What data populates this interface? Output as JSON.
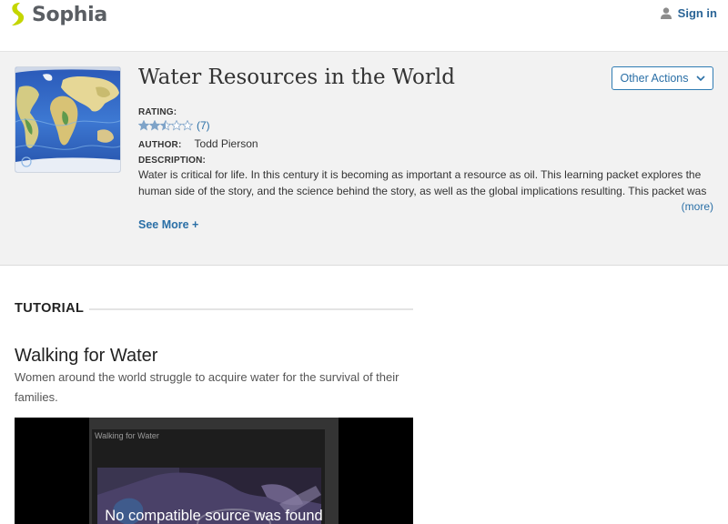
{
  "header": {
    "brand": "Sophia",
    "signin_label": "Sign in",
    "brand_color": "#c4d600",
    "link_color": "#2a6496"
  },
  "resource": {
    "title": "Water Resources in the World",
    "other_actions_label": "Other Actions",
    "rating_label": "RATING:",
    "rating_value": 2.5,
    "rating_max": 5,
    "rating_count": "(7)",
    "author_label": "AUTHOR:",
    "author_name": "Todd Pierson",
    "description_label": "DESCRIPTION:",
    "description_line1": "Water is critical for life.  In this century it is becoming as important a resource as oil.  This learning packet explores the",
    "description_line2": "human side of the story, and the science behind the story, as well as the global implications resulting.  This packet was",
    "more_label": "(more)",
    "see_more_label": "See More +"
  },
  "tutorial": {
    "section_label": "TUTORIAL",
    "title": "Walking for Water",
    "subtitle": "Women around the world struggle to acquire water for the survival of their families.",
    "video_caption": "Walking for Water",
    "video_error": "No compatible source was found"
  }
}
